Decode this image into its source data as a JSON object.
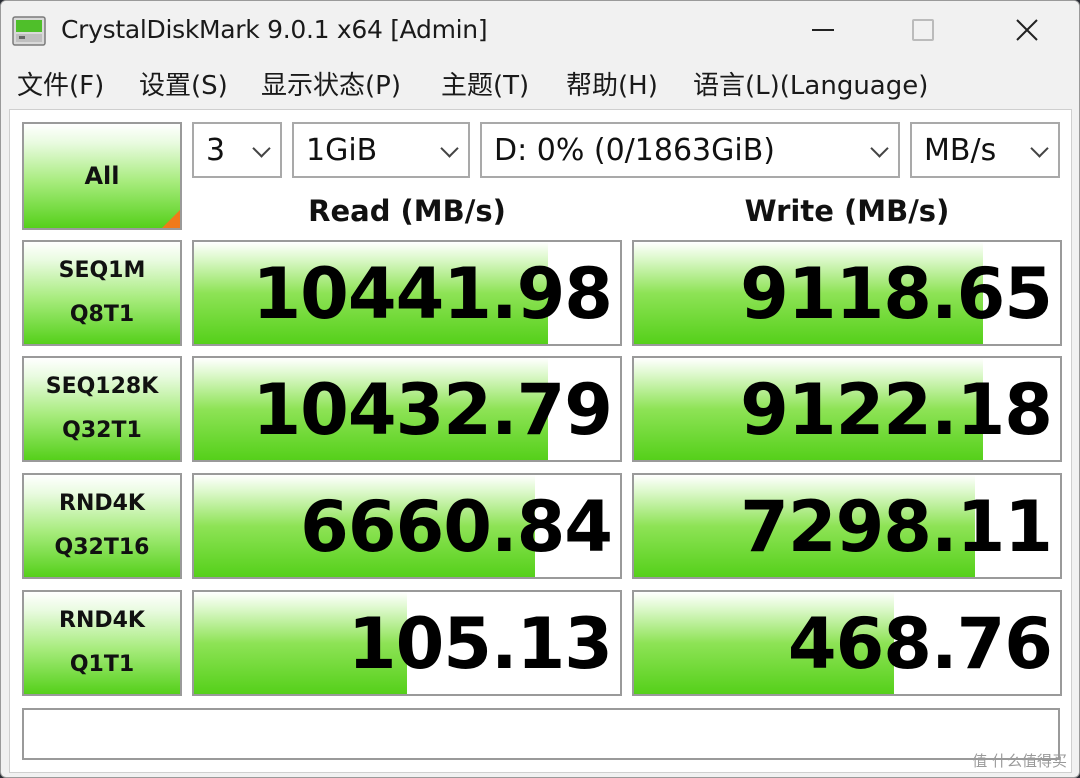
{
  "window": {
    "title": "CrystalDiskMark 9.0.1 x64 [Admin]"
  },
  "menu": [
    {
      "label": "文件(F)"
    },
    {
      "label": "设置(S)"
    },
    {
      "label": "显示状态(P)"
    },
    {
      "label": "主题(T)"
    },
    {
      "label": "帮助(H)"
    },
    {
      "label": "语言(L)(Language)"
    }
  ],
  "controls": {
    "all_label": "All",
    "count": "3",
    "size": "1GiB",
    "drive": "D: 0% (0/1863GiB)",
    "unit": "MB/s"
  },
  "headers": {
    "read": "Read (MB/s)",
    "write": "Write (MB/s)"
  },
  "tests": [
    {
      "line1": "SEQ1M",
      "line2": "Q8T1",
      "read": "10441.98",
      "write": "9118.65",
      "read_fill": 0.83,
      "write_fill": 0.82
    },
    {
      "line1": "SEQ128K",
      "line2": "Q32T1",
      "read": "10432.79",
      "write": "9122.18",
      "read_fill": 0.83,
      "write_fill": 0.82
    },
    {
      "line1": "RND4K",
      "line2": "Q32T16",
      "read": "6660.84",
      "write": "7298.11",
      "read_fill": 0.8,
      "write_fill": 0.8
    },
    {
      "line1": "RND4K",
      "line2": "Q1T1",
      "read": "105.13",
      "write": "468.76",
      "read_fill": 0.5,
      "write_fill": 0.61
    }
  ],
  "status": "",
  "watermark": "值 什么值得买",
  "colors": {
    "bar_green": "#55d01a",
    "corner_orange": "#f07a1a"
  },
  "icons": {
    "app": "crystaldiskmark-icon",
    "minimize": "minimize-icon",
    "maximize": "maximize-icon",
    "close": "close-icon",
    "dropdown": "chevron-down-icon"
  }
}
